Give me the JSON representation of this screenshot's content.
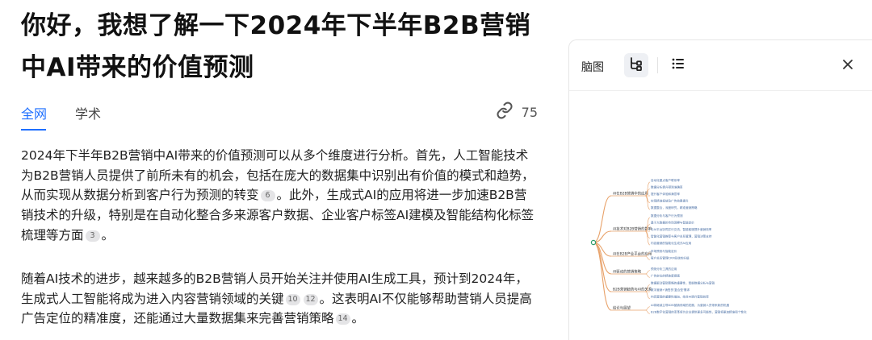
{
  "page": {
    "title_line1": "你好，我想了解一下2024年下半年B2B营销",
    "title_line2": "中AI带来的价值预测"
  },
  "tabs": [
    {
      "label": "全网",
      "active": true
    },
    {
      "label": "学术",
      "active": false
    }
  ],
  "links_count": "75",
  "paragraph1": {
    "s1": "2024年下半年B2B营销中AI带来的价值预测可以从多个维度进行分析。首先，人工智能技术为B2B营销人员提供了前所未有的机会，包括在庞大的数据集中识别出有价值的模式和趋势，从而实现从数据分析到客户行为预测的转变",
    "c1": "6",
    "s2": "。此外，生成式AI的应用将进一步加速B2B营销技术的升级，特别是在自动化整合多来源客户数据、企业客户标签AI建模及智能结构化标签梳理等方面",
    "c2": "3",
    "s3": "。"
  },
  "paragraph2": {
    "s1": "随着AI技术的进步，越来越多的B2B营销人员开始关注并使用AI生成工具，预计到2024年，生成式人工智能将成为进入内容营销领域的关键",
    "c1": "10",
    "c2": "12",
    "s2": "。这表明AI不仅能够帮助营销人员提高广告定位的精准度，还能通过大量数据集来完善营销策略",
    "c3": "14",
    "s3": "。"
  },
  "mindmap_panel": {
    "label": "脑图",
    "icons": [
      "mindmap-tree-icon",
      "list-icon",
      "close-icon"
    ],
    "branches": [
      {
        "label": "AI在B2B营销中的应用",
        "leaves": [
          "自动化重点客户联系率",
          "数据分析提升预测准确率",
          "提升客户体验和满意率",
          "实现精准投放及广告效果提升",
          "数据整合，深度研究，精准营销策略"
        ]
      },
      {
        "label": "AI技术对B2B营销的影响",
        "leaves": [
          "数据分析与客户行为预测",
          "基于大数据的市场洞察与智能定价",
          "与AI平台协同并行交流，智能客服提升营销效率",
          "智能化营销推荐与客户关系管理，营销决策支持",
          "内容营销的智能化生成式AI应用"
        ]
      },
      {
        "label": "AI在B2B产业平台的应用",
        "leaves": [
          "市场预测与智能定价",
          "客户关系管理CRM系统的升级"
        ]
      },
      {
        "label": "AI驱动的营销策略",
        "leaves": [
          "预测分析工具的应用",
          "广告定位的精准度提高"
        ]
      },
      {
        "label": "B2B营销趋势与AI的关系",
        "leaves": [
          "数据驱动营销策略的重要性，智能数据分析与营销",
          "数字营销+销售的'复合型'需求",
          "内容营销的重要性增加，结合AI提升营销效率"
        ]
      },
      {
        "label": "结论与展望",
        "leaves": [
          "AI将继续主导B2B营销领域的发展，为营销人员带来新的机遇",
          "B2B数字化营销的变革将为企业提供更多可能性，营销将更加精准和个性化"
        ]
      }
    ],
    "colors": {
      "branch": "#e8a26a",
      "root": "#2e9e6b",
      "leaf_text": "#4a6fa5"
    }
  }
}
